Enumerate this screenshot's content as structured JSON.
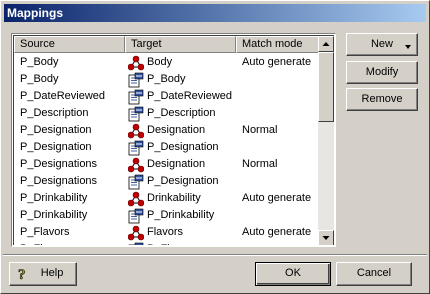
{
  "window": {
    "title": "Mappings"
  },
  "list": {
    "columns": [
      "Source",
      "Target",
      "Match mode"
    ],
    "rows": [
      {
        "source": "P_Body",
        "target": "Body",
        "target_icon": "relation-icon",
        "mode": "Auto generate"
      },
      {
        "source": "P_Body",
        "target": "P_Body",
        "target_icon": "document-icon",
        "mode": ""
      },
      {
        "source": "P_DateReviewed",
        "target": "P_DateReviewed",
        "target_icon": "document-icon",
        "mode": ""
      },
      {
        "source": "P_Description",
        "target": "P_Description",
        "target_icon": "document-icon",
        "mode": ""
      },
      {
        "source": "P_Designation",
        "target": "Designation",
        "target_icon": "relation-icon",
        "mode": "Normal"
      },
      {
        "source": "P_Designation",
        "target": "P_Designation",
        "target_icon": "document-icon",
        "mode": ""
      },
      {
        "source": "P_Designations",
        "target": "Designation",
        "target_icon": "relation-icon",
        "mode": "Normal"
      },
      {
        "source": "P_Designations",
        "target": "P_Designation",
        "target_icon": "document-icon",
        "mode": ""
      },
      {
        "source": "P_Drinkability",
        "target": "Drinkability",
        "target_icon": "relation-icon",
        "mode": "Auto generate"
      },
      {
        "source": "P_Drinkability",
        "target": "P_Drinkability",
        "target_icon": "document-icon",
        "mode": ""
      },
      {
        "source": "P_Flavors",
        "target": "Flavors",
        "target_icon": "relation-icon",
        "mode": "Auto generate"
      },
      {
        "source": "P_Flavors",
        "target": "P_Flavors",
        "target_icon": "document-icon",
        "mode": ""
      }
    ]
  },
  "buttons": {
    "new": "New",
    "modify": "Modify",
    "remove": "Remove",
    "help": "Help",
    "ok": "OK",
    "cancel": "Cancel"
  }
}
